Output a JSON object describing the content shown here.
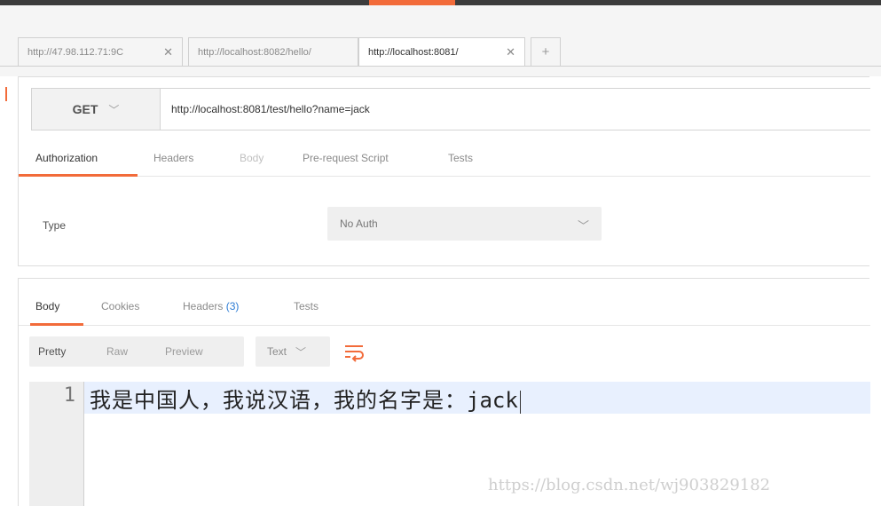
{
  "tabs": [
    {
      "label": "http://47.98.112.71:9C",
      "active": false
    },
    {
      "label": "http://localhost:8082/hello/",
      "active": false
    },
    {
      "label": "http://localhost:8081/",
      "active": true
    }
  ],
  "tab_close_glyph": "✕",
  "add_tab_glyph": "+",
  "request": {
    "method": "GET",
    "url": "http://localhost:8081/test/hello?name=jack"
  },
  "request_tabs": [
    "Authorization",
    "Headers",
    "Body",
    "Pre-request Script",
    "Tests"
  ],
  "auth": {
    "type_label": "Type",
    "type_value": "No Auth"
  },
  "response_tabs": {
    "body": "Body",
    "cookies": "Cookies",
    "headers": "Headers",
    "headers_count": "(3)",
    "tests": "Tests"
  },
  "view_modes": [
    "Pretty",
    "Raw",
    "Preview"
  ],
  "format": "Text",
  "editor": {
    "line_number": "1",
    "text_cjk": "我是中国人，我说汉语，我的名字是：",
    "text_latin": "jack"
  },
  "watermark": "https://blog.csdn.net/wj903829182",
  "colors": {
    "accent": "#f26b3a",
    "link": "#2a7ad4"
  },
  "icons": [
    "close-icon",
    "plus-icon",
    "chevron-down-icon",
    "wrap-lines-icon"
  ]
}
